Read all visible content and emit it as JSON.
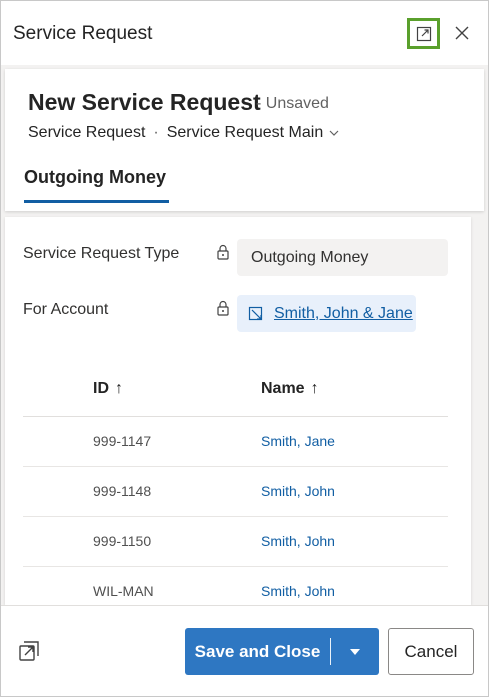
{
  "dialog": {
    "title": "Service Request",
    "popout_icon": "popout-icon",
    "close_icon": "close-icon"
  },
  "header": {
    "record_title": "New Service Request",
    "status": "- Unsaved",
    "entity": "Service Request",
    "separator": "·",
    "form_name": "Service Request Main",
    "tab": "Outgoing Money"
  },
  "fields": {
    "type": {
      "label": "Service Request Type",
      "value": "Outgoing Money"
    },
    "account": {
      "label": "For Account",
      "value": "Smith, John & Jane"
    }
  },
  "grid": {
    "columns": [
      {
        "label": "ID",
        "arrow": "↑"
      },
      {
        "label": "Name",
        "arrow": "↑"
      }
    ],
    "rows": [
      {
        "id": "999-1147",
        "name": "Smith, Jane"
      },
      {
        "id": "999-1148",
        "name": "Smith, John"
      },
      {
        "id": "999-1150",
        "name": "Smith, John"
      },
      {
        "id": "WIL-MAN",
        "name": "Smith, John"
      }
    ]
  },
  "footer": {
    "save_label": "Save and Close",
    "cancel_label": "Cancel"
  },
  "colors": {
    "primary": "#2e77c2",
    "link": "#115ea3",
    "highlight": "#5aa02c"
  }
}
